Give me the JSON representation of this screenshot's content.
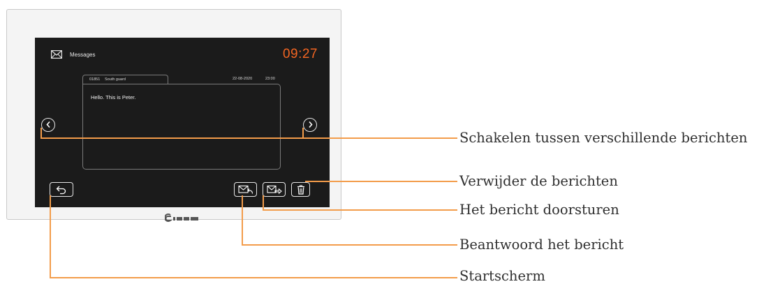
{
  "header": {
    "title": "Messages",
    "clock": "09:27",
    "mail_icon": "envelope-icon"
  },
  "message": {
    "number": "01851",
    "sender": "South guard",
    "date": "22-08-2020",
    "time": "23:00",
    "body": "Hello. This is Peter."
  },
  "buttons": {
    "previous": "chevron-left-icon",
    "next": "chevron-right-icon",
    "home": "return-icon",
    "reply": "reply-mail-icon",
    "forward": "forward-mail-icon",
    "delete": "trash-icon"
  },
  "callouts": {
    "switch": "Schakelen tussen verschillende berichten",
    "delete": "Verwijder de berichten",
    "forward": "Het bericht doorsturen",
    "reply": "Beantwoord het bericht",
    "home": "Startscherm"
  },
  "colors": {
    "accent": "#f26522",
    "callout_line": "#f39c4a",
    "screen": "#1b1b1b"
  }
}
